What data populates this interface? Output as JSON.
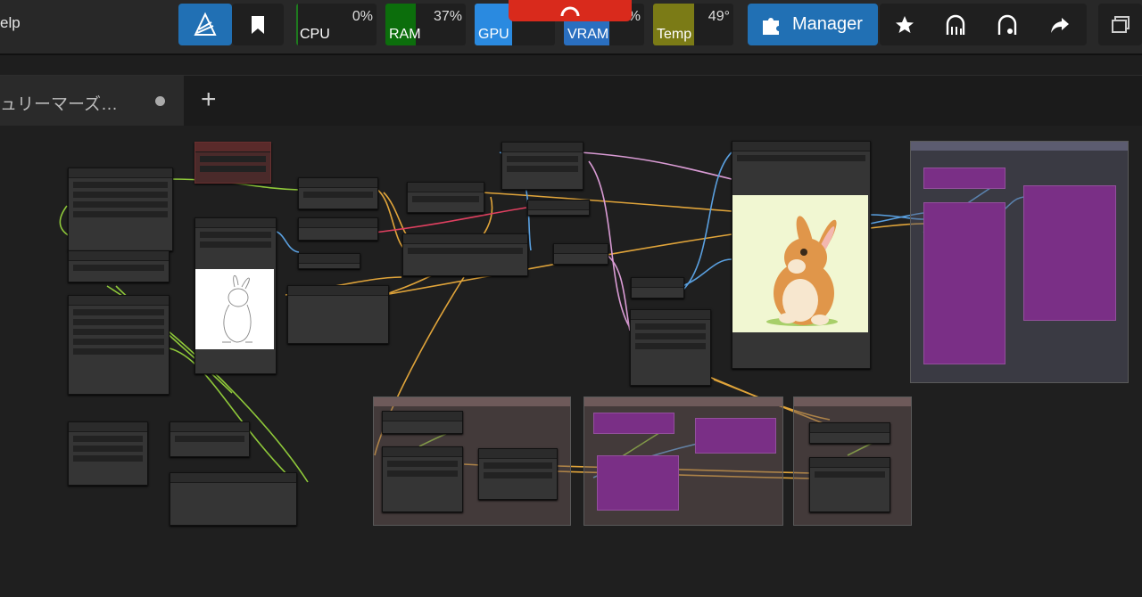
{
  "menu": {
    "help_label": "elp"
  },
  "toolbar": {
    "meters": [
      {
        "label": "CPU",
        "value": "0%",
        "fill_fraction": 0.02,
        "color": "#1e7a1e"
      },
      {
        "label": "RAM",
        "value": "37%",
        "fill_fraction": 0.37,
        "color": "#0c6e0c"
      },
      {
        "label": "GPU",
        "value": "",
        "fill_fraction": 0.45,
        "color": "#2a8ae0"
      },
      {
        "label": "VRAM",
        "value": "%",
        "fill_fraction": 0.55,
        "color": "#2a6fc0"
      },
      {
        "label": "Temp",
        "value": "49°",
        "fill_fraction": 0.49,
        "color": "#7b7b16"
      }
    ],
    "manager_label": "Manager",
    "icons": [
      "comfy-logo-icon",
      "bookmark-icon",
      "star-icon",
      "ghost-icon",
      "ghost-alt-icon",
      "share-icon",
      "gallery-icon"
    ]
  },
  "tabs": [
    {
      "title": "ュリーマーズ…",
      "modified": true
    }
  ],
  "colors": {
    "accent": "#2170b4",
    "notch": "#d92a1c",
    "group_purple": "#7a2f86",
    "wire_yellow": "#e0a43a",
    "wire_green": "#8fc93a",
    "wire_blue": "#5aa0e0",
    "wire_pink": "#d99bd4",
    "wire_red": "#e04060"
  }
}
